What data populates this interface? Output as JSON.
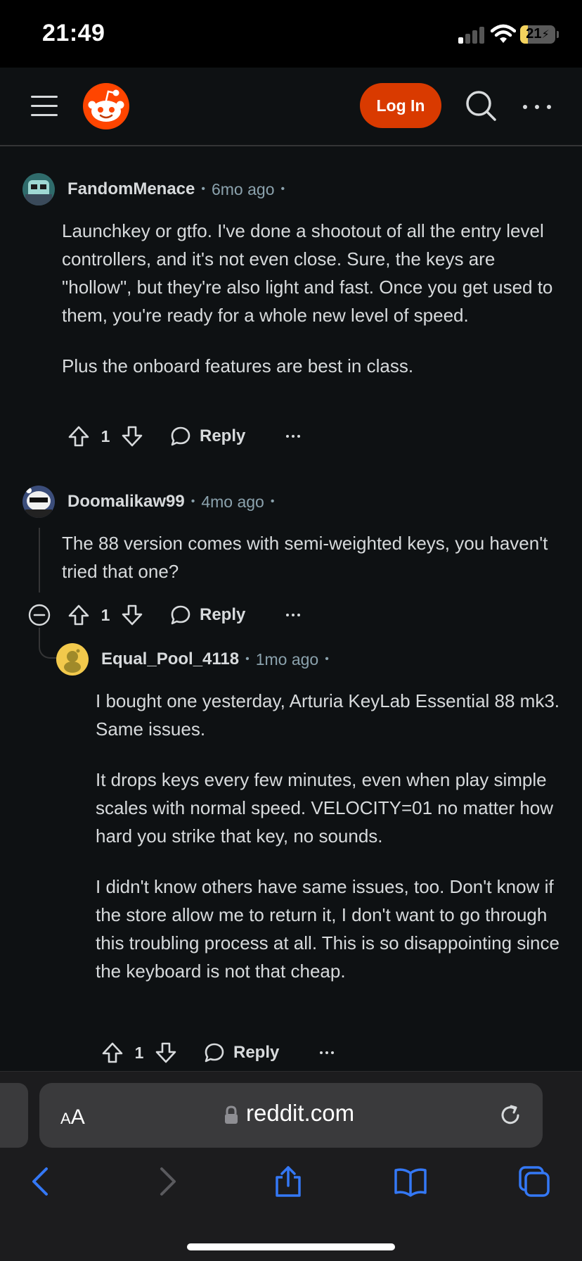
{
  "status_bar": {
    "time": "21:49",
    "battery_level": "21",
    "battery_fill_percent": 21,
    "battery_color": "#f4d35e"
  },
  "header": {
    "menu_icon": "hamburger-menu-icon",
    "logo_icon": "reddit-snoo-logo",
    "login_label": "Log In",
    "login_color": "#d93a00",
    "search_icon": "search-icon",
    "more_icon": "more-horizontal-icon"
  },
  "comments": [
    {
      "author": "FandomMenace",
      "age": "6mo ago",
      "paragraphs": [
        "Launchkey or gtfo. I've done a shootout of all the entry level controllers, and it's not even close. Sure, the keys are \"hollow\", but they're also light and fast. Once you get used to them, you're ready for a whole new level of speed.",
        "Plus the onboard features are best in class."
      ],
      "score": "1",
      "reply_label": "Reply"
    },
    {
      "author": "Doomalikaw99",
      "age": "4mo ago",
      "paragraphs": [
        "The 88 version comes with semi-weighted keys, you haven't tried that one?"
      ],
      "score": "1",
      "reply_label": "Reply"
    },
    {
      "author": "Equal_Pool_4118",
      "age": "1mo ago",
      "paragraphs": [
        "I bought one yesterday, Arturia KeyLab Essential 88 mk3. Same issues.",
        "It drops keys every few minutes, even when play simple scales with normal speed. VELOCITY=01 no matter how hard you strike that key, no sounds.",
        "I didn't know others have same issues, too. Don't know if the store allow me to return it, I don't want to go through this troubling process at all. This is so disappointing since the keyboard is not that cheap."
      ],
      "score": "1",
      "reply_label": "Reply"
    }
  ],
  "safari": {
    "text_size_small": "A",
    "text_size_big": "A",
    "domain": "reddit.com",
    "accent_color": "#3478f6"
  }
}
